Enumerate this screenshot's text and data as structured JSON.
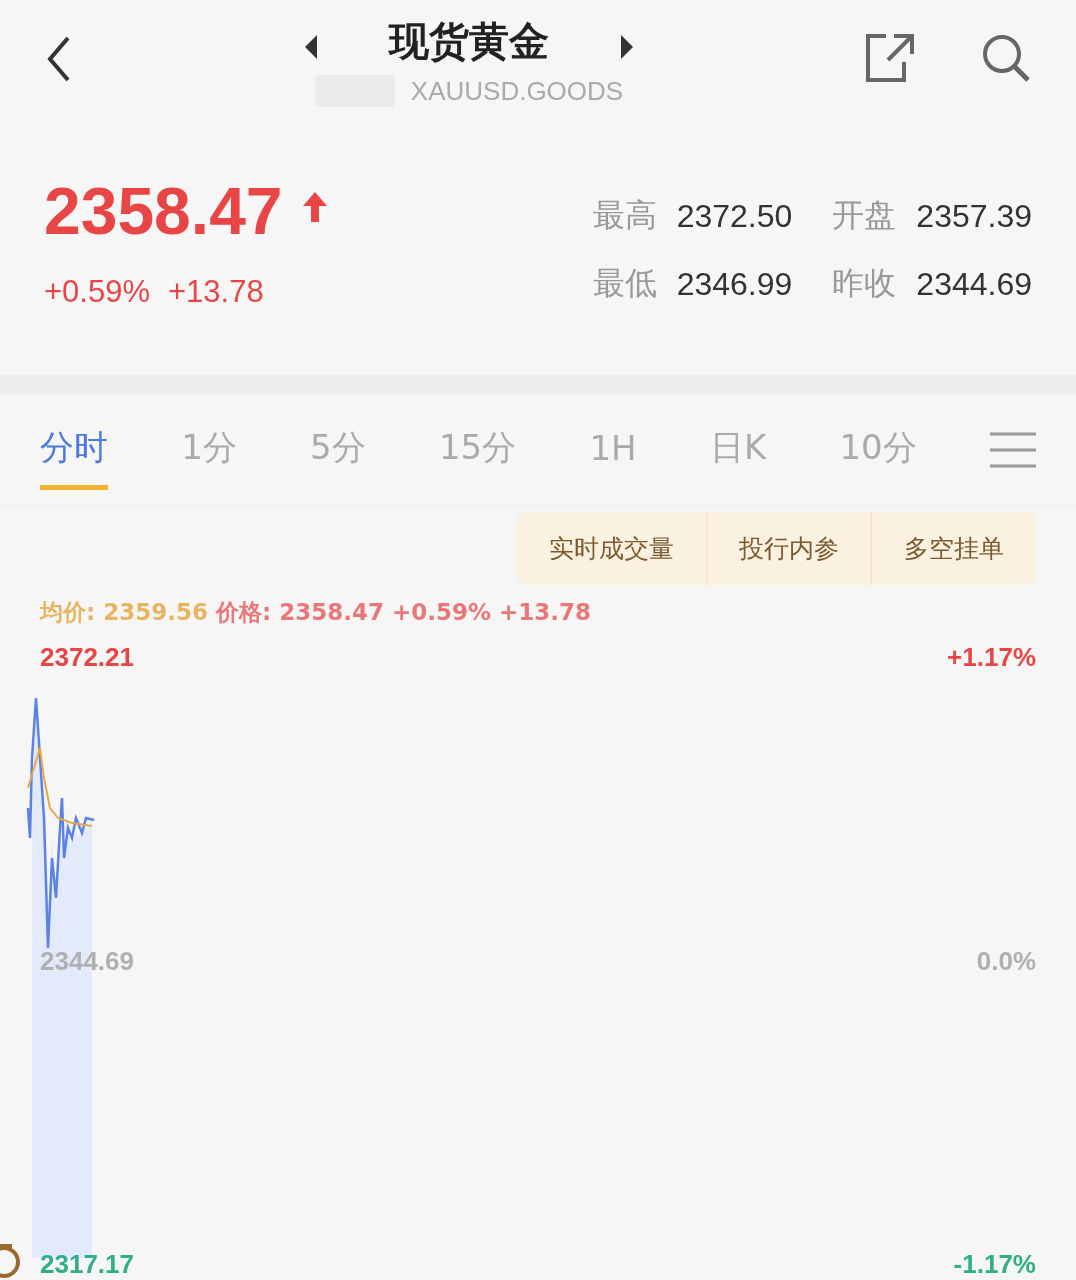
{
  "header": {
    "title": "现货黄金",
    "symbol": "XAUUSD.GOODS"
  },
  "quote": {
    "price": "2358.47",
    "rising": true,
    "change_pct": "+0.59%",
    "change": "+13.78",
    "stats": [
      {
        "label": "最高",
        "value": "2372.50"
      },
      {
        "label": "开盘",
        "value": "2357.39"
      },
      {
        "label": "最低",
        "value": "2346.99"
      },
      {
        "label": "昨收",
        "value": "2344.69"
      }
    ]
  },
  "tabs": [
    {
      "label": "分时",
      "selected": true
    },
    {
      "label": "1分",
      "selected": false
    },
    {
      "label": "5分",
      "selected": false
    },
    {
      "label": "15分",
      "selected": false
    },
    {
      "label": "1H",
      "selected": false
    },
    {
      "label": "日K",
      "selected": false
    },
    {
      "label": "10分",
      "selected": false
    }
  ],
  "chips": [
    "实时成交量",
    "投行内参",
    "多空挂单"
  ],
  "legend": {
    "avg_label": "均价:",
    "avg_value": "2359.56",
    "price_label": "价格:",
    "price_value": "2358.47",
    "change_pct": "+0.59%",
    "change": "+13.78"
  },
  "chart": {
    "y_labels": [
      {
        "price": "2372.21",
        "pct": "+1.17%",
        "kind": "up"
      },
      {
        "price": "2344.69",
        "pct": "0.0%",
        "kind": "flat"
      },
      {
        "price": "2317.17",
        "pct": "-1.17%",
        "kind": "down"
      }
    ]
  }
}
